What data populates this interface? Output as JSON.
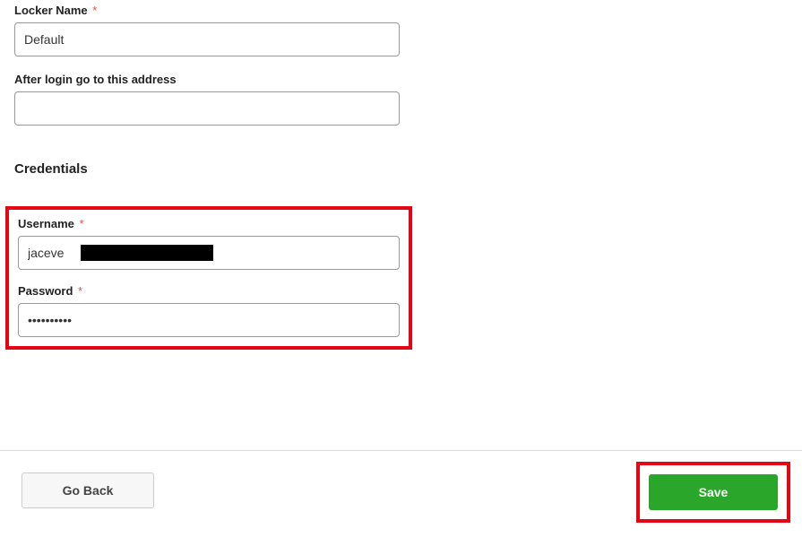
{
  "locker": {
    "label": "Locker Name",
    "value": "Default"
  },
  "address": {
    "label": "After login go to this address",
    "value": ""
  },
  "credentials": {
    "heading": "Credentials",
    "username": {
      "label": "Username",
      "value": "jaceve"
    },
    "password": {
      "label": "Password",
      "value": "••••••••••"
    }
  },
  "buttons": {
    "go_back": "Go Back",
    "save": "Save"
  },
  "required_marker": "*"
}
